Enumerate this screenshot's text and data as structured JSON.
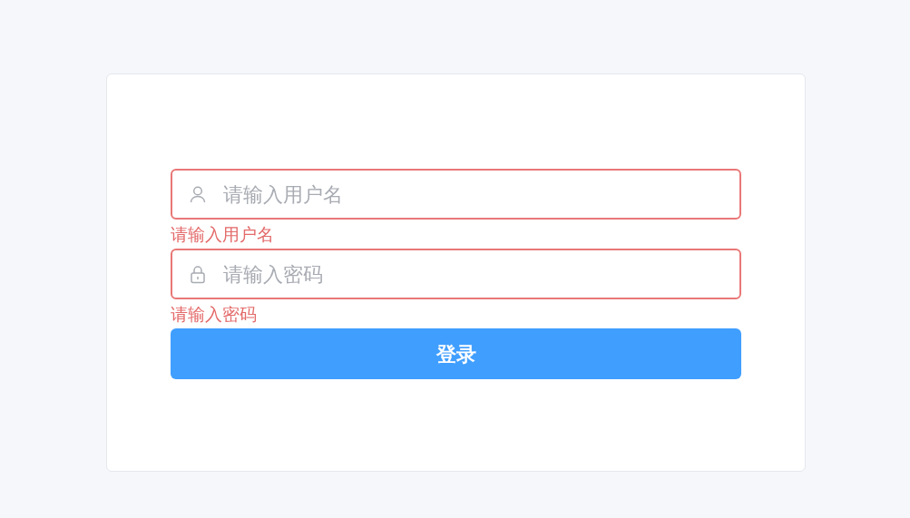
{
  "login_form": {
    "fields": [
      {
        "kind": "user",
        "placeholder": "请输入用户名",
        "invalid": true,
        "error": "请输入用户名"
      },
      {
        "kind": "password",
        "placeholder": "请输入密码",
        "invalid": true,
        "error": "请输入密码"
      }
    ],
    "submit_button": "登录"
  }
}
